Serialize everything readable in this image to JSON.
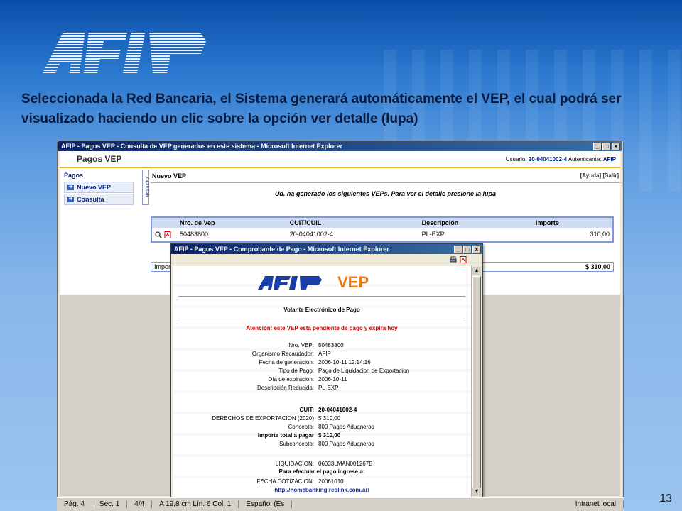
{
  "slide": {
    "logo_text": "AFIP",
    "heading": "Seleccionada la Red Bancaria, el Sistema generará automáticamente el VEP, el cual podrá ser visualizado haciendo un clic sobre la opción ver detalle (lupa)",
    "page_number": "13"
  },
  "ie_main": {
    "title": "AFIP - Pagos VEP - Consulta de VEP generados en este sistema - Microsoft Internet Explorer",
    "app_title": "Pagos VEP",
    "user_label": "Usuario:",
    "user_value": "20-04041002-4",
    "auth_label": "Autenticante:",
    "auth_value": "AFIP",
    "sidebar_header": "Pagos",
    "sidebar_items": [
      "Nuevo VEP",
      "Consulta"
    ],
    "ocultar": "OCULTAR",
    "section_title": "Nuevo VEP",
    "links": "[Ayuda] [Salir]",
    "message": "Ud. ha generado los siguientes VEPs. Para ver el detalle presione la lupa",
    "table_headers": [
      "Nro. de Vep",
      "CUIT/CUIL",
      "Descripción",
      "Importe"
    ],
    "table_rows": [
      {
        "vep": "50483800",
        "cuit": "20-04041002-4",
        "desc": "PL-EXP",
        "importe": "310,00"
      }
    ],
    "total_label": "Importe Total a pagar",
    "total_value": "$ 310,00"
  },
  "popup": {
    "title": "AFIP - Pagos VEP - Comprobante de Pago - Microsoft Internet Explorer",
    "logo": "AFIP",
    "logo_suffix": "VEP",
    "doc_title": "Volante Electrónico de Pago",
    "warning": "Atención: este VEP esta pendiente de pago y expira hoy",
    "fields": [
      {
        "k": "Nro. VEP:",
        "v": "50483800"
      },
      {
        "k": "Organismo Recaudador:",
        "v": "AFIP"
      },
      {
        "k": "Fecha de generación:",
        "v": "2006-10-11 12:14:16"
      },
      {
        "k": "Tipo de Pago:",
        "v": "Pago de Liquidacion de Exportacion"
      },
      {
        "k": "Día de expiración:",
        "v": "2006-10-11"
      },
      {
        "k": "Descripción Reducida:",
        "v": "PL-EXP"
      }
    ],
    "fields2": [
      {
        "k": "CUIT:",
        "v": "20-04041002-4",
        "bold": true
      },
      {
        "k": "DERECHOS DE EXPORTACION (2020)",
        "v": "$ 310,00",
        "bold": false
      },
      {
        "k": "Concepto:",
        "v": "800 Pagos Aduaneros",
        "bold": false
      },
      {
        "k": "Importe total a pagar",
        "v": "$ 310,00",
        "bold": true
      },
      {
        "k": "Subconcepto:",
        "v": "800 Pagos Aduaneros",
        "bold": false
      }
    ],
    "liquidacion_k": "LIQUIDACION:",
    "liquidacion_v": "06033LMAN001267B",
    "pago_msg": "Para efectuar el pago ingrese a:",
    "cotiz_k": "FECHA COTIZACION:",
    "cotiz_v": "20061010",
    "url": "http://homebanking.redlink.com.ar/"
  },
  "status": {
    "pag": "Pág. 4",
    "sec": "Sec. 1",
    "pages": "4/4",
    "pos": "A 19,8 cm  Lín. 6   Col. 1",
    "lang": "Español (Es",
    "zone": "Intranet local"
  }
}
